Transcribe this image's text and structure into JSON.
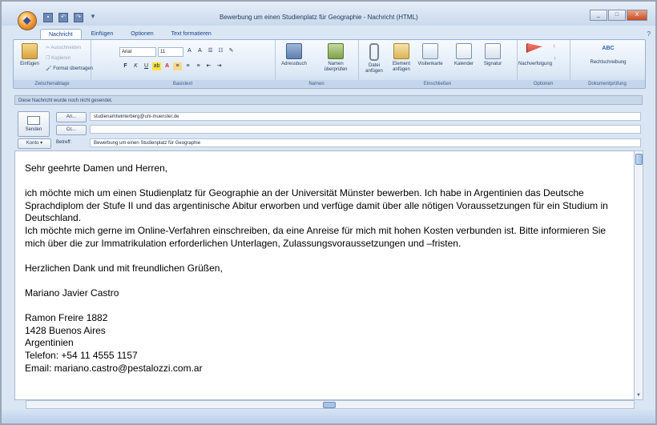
{
  "window": {
    "title": "Bewerbung um einen Studienplatz für Geographie - Nachricht (HTML)",
    "controls": {
      "minimize": "_",
      "maximize": "□",
      "close": "X"
    }
  },
  "app_icons": [
    "office-orb-icon",
    "save-icon",
    "undo-icon",
    "redo-icon"
  ],
  "tabs": [
    {
      "label": "Nachricht",
      "active": true
    },
    {
      "label": "Einfügen",
      "active": false
    },
    {
      "label": "Optionen",
      "active": false
    },
    {
      "label": "Text formatieren",
      "active": false
    }
  ],
  "ribbon": {
    "clipboard": {
      "paste_label": "Einfügen",
      "cut_label": "Ausschneiden",
      "copy_label": "Kopieren",
      "format_painter_label": "Format übertragen",
      "group_label": "Zwischenablage"
    },
    "basic_text": {
      "font_name": "Arial",
      "font_size": "11",
      "group_label": "Basistext",
      "format_buttons": [
        "F",
        "K",
        "U"
      ]
    },
    "names": {
      "address_book_label": "Adressbuch",
      "check_names_label": "Namen überprüfen",
      "group_label": "Namen"
    },
    "include": {
      "attach_file_label": "Datei anfügen",
      "attach_item_label": "Element anfügen",
      "business_card_label": "Visitenkarte",
      "calendar_label": "Kalender",
      "signature_label": "Signatur",
      "group_label": "Einschließen"
    },
    "options": {
      "followup_label": "Nachverfolgung",
      "group_label": "Optionen"
    },
    "spelling": {
      "label": "Rechtschreibung",
      "icon_text": "ABC",
      "group_label": "Dokumentprüfung"
    }
  },
  "infobar": "Diese Nachricht wurde noch nicht gesendet.",
  "header": {
    "send_label": "Senden",
    "to_button": "An...",
    "cc_button": "Cc...",
    "to_value": "studienamtwinterberg@uni-muenster.de",
    "cc_value": "",
    "account_button": "Konto",
    "subject_label": "Betreff:",
    "subject_value": "Bewerbung um einen Studienplatz für Geographie"
  },
  "message": {
    "greeting": "Sehr geehrte Damen und Herren,",
    "paragraph1": "ich möchte mich um einen Studienplatz für Geographie an der Universität Münster bewerben. Ich habe in Argentinien das Deutsche Sprachdiplom der Stufe II und das argentinische Abitur erworben und verfüge damit über alle nötigen Voraussetzungen für ein Studium in Deutschland.",
    "paragraph2": "Ich möchte mich gerne im Online-Verfahren einschreiben, da eine Anreise für mich mit hohen Kosten verbunden ist. Bitte informieren Sie mich über die zur Immatrikulation erforderlichen Unterlagen, Zulassungsvoraussetzungen und –fristen.",
    "closing": "Herzlichen Dank und mit freundlichen Grüßen,",
    "signature_name": "Mariano Javier Castro",
    "address_street": "Ramon Freire 1882",
    "address_city": "1428 Buenos Aires",
    "address_country": "Argentinien",
    "phone": "Telefon: +54 11 4555 1157",
    "email": "Email: mariano.castro@pestalozzi.com.ar"
  }
}
